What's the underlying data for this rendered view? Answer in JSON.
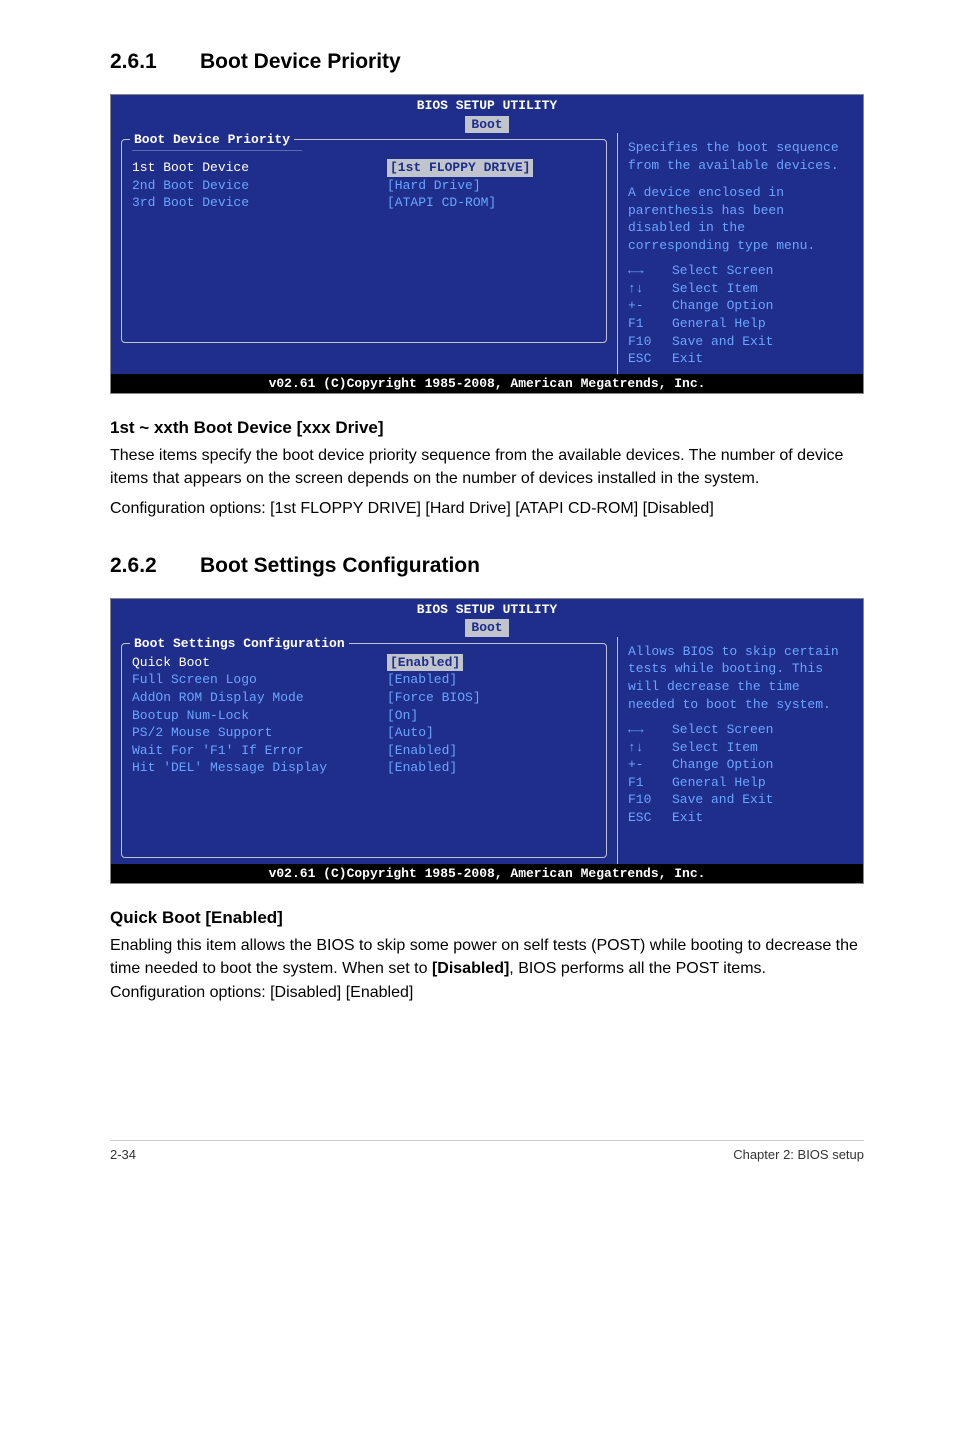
{
  "section1": {
    "number": "2.6.1",
    "title": "Boot Device Priority"
  },
  "bios1": {
    "utility_title": "BIOS SETUP UTILITY",
    "tab": "Boot",
    "panel_title": "Boot Device Priority",
    "rows": [
      {
        "label": "1st Boot Device",
        "value": "[1st FLOPPY DRIVE]",
        "selected": true
      },
      {
        "label": "2nd Boot Device",
        "value": "[Hard Drive]",
        "selected": false
      },
      {
        "label": "3rd Boot Device",
        "value": "[ATAPI CD-ROM]",
        "selected": false
      }
    ],
    "help1": "Specifies the boot sequence from the available devices.",
    "help2": "A device enclosed in parenthesis has been disabled in the corresponding type menu.",
    "keys": [
      {
        "k": "←→",
        "t": "Select Screen"
      },
      {
        "k": "↑↓",
        "t": "Select Item"
      },
      {
        "k": "+-",
        "t": "Change Option"
      },
      {
        "k": "F1",
        "t": "General Help"
      },
      {
        "k": "F10",
        "t": "Save and Exit"
      },
      {
        "k": "ESC",
        "t": "Exit"
      }
    ],
    "footer": "v02.61 (C)Copyright 1985-2008, American Megatrends, Inc."
  },
  "para1": {
    "heading": "1st ~ xxth Boot Device [xxx Drive]",
    "line1": "These items specify the boot device priority sequence from the available devices. The number of device items that appears on the screen depends on the number of devices installed in the system.",
    "line2": "Configuration options: [1st FLOPPY DRIVE] [Hard Drive] [ATAPI CD-ROM] [Disabled]"
  },
  "section2": {
    "number": "2.6.2",
    "title": "Boot Settings Configuration"
  },
  "bios2": {
    "utility_title": "BIOS SETUP UTILITY",
    "tab": "Boot",
    "panel_title": "Boot Settings Configuration",
    "rows": [
      {
        "label": "Quick Boot",
        "value": "[Enabled]",
        "selected": true
      },
      {
        "label": "Full Screen Logo",
        "value": "[Enabled]",
        "selected": false
      },
      {
        "label": "AddOn ROM Display Mode",
        "value": "[Force BIOS]",
        "selected": false
      },
      {
        "label": "Bootup Num-Lock",
        "value": "[On]",
        "selected": false
      },
      {
        "label": "PS/2 Mouse Support",
        "value": "[Auto]",
        "selected": false
      },
      {
        "label": "Wait For 'F1' If Error",
        "value": "[Enabled]",
        "selected": false
      },
      {
        "label": "Hit 'DEL' Message Display",
        "value": "[Enabled]",
        "selected": false
      }
    ],
    "help1": "Allows BIOS to skip certain tests while booting. This will decrease the time needed to boot the system.",
    "keys": [
      {
        "k": "←→",
        "t": "Select Screen"
      },
      {
        "k": "↑↓",
        "t": "Select Item"
      },
      {
        "k": "+-",
        "t": "Change Option"
      },
      {
        "k": "F1",
        "t": "General Help"
      },
      {
        "k": "F10",
        "t": "Save and Exit"
      },
      {
        "k": "ESC",
        "t": "Exit"
      }
    ],
    "footer": "v02.61 (C)Copyright 1985-2008, American Megatrends, Inc."
  },
  "para2": {
    "heading": "Quick Boot [Enabled]",
    "line1a": "Enabling this item allows the BIOS to skip some power on self tests (POST) while booting to decrease the time needed to boot the system. When set to ",
    "bold": "[Disabled]",
    "line1b": ", BIOS performs all the POST items. Configuration options: [Disabled] [Enabled]"
  },
  "footer": {
    "left": "2-34",
    "right": "Chapter 2: BIOS setup"
  },
  "chart_data": null
}
